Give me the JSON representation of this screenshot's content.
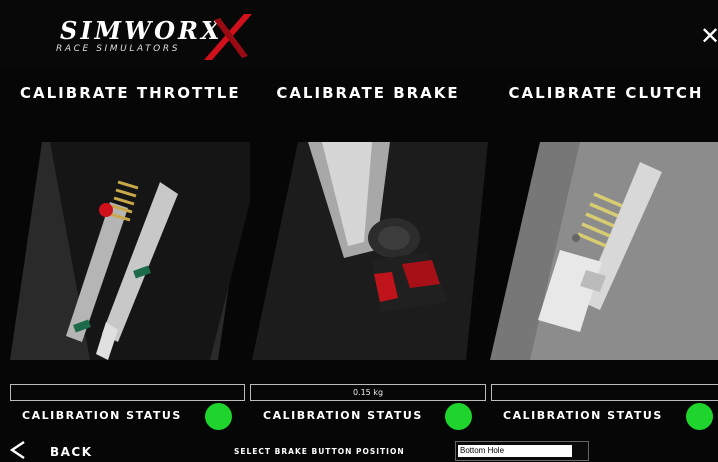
{
  "header": {
    "logo_main": "SIMWORX",
    "logo_sub": "RACE SIMULATORS",
    "close_label": "✕"
  },
  "panels": [
    {
      "title": "CALIBRATE THROTTLE",
      "value": "",
      "status_label": "CALIBRATION STATUS",
      "status_color": "#1fd42c"
    },
    {
      "title": "CALIBRATE BRAKE",
      "value": "0.15 kg",
      "status_label": "CALIBRATION STATUS",
      "status_color": "#1fd42c"
    },
    {
      "title": "CALIBRATE CLUTCH",
      "value": "",
      "status_label": "CALIBRATION STATUS",
      "status_color": "#1fd42c"
    }
  ],
  "footer": {
    "back_label": "BACK",
    "select_label": "SELECT BRAKE BUTTON POSITION",
    "select_value": "Bottom Hole"
  },
  "colors": {
    "accent_red": "#d0101a",
    "status_green": "#1fd42c"
  }
}
